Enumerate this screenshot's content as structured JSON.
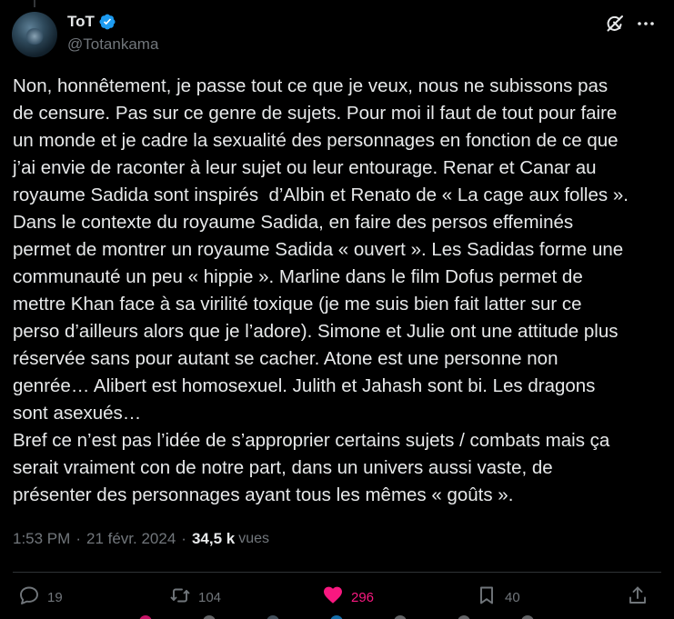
{
  "colors": {
    "accent_blue": "#1d9bf0",
    "like_pink": "#f91880",
    "muted": "#71767b",
    "text": "#e7e9ea",
    "bg": "#000000"
  },
  "author": {
    "display_name": "ToT",
    "handle": "@Totankama",
    "verified": true
  },
  "post": {
    "text": "Non, honnêtement, je passe tout ce que je veux, nous ne subissons pas\nde censure. Pas sur ce genre de sujets. Pour moi il faut de tout pour faire\nun monde et je cadre la sexualité des personnages en fonction de ce que\nj’ai envie de raconter à leur sujet ou leur entourage. Renar et Canar au\nroyaume Sadida sont inspirés  d’Albin et Renato de « La cage aux folles ».\nDans le contexte du royaume Sadida, en faire des persos effeminés\npermet de montrer un royaume Sadida « ouvert ». Les Sadidas forme une\ncommunauté un peu « hippie ». Marline dans le film Dofus permet de\nmettre Khan face à sa virilité toxique (je me suis bien fait latter sur ce\nperso d’ailleurs alors que je l’adore). Simone et Julie ont une attitude plus\nréservée sans pour autant se cacher. Atone est une personne non\ngenrée… Alibert est homosexuel. Julith et Jahash sont bi. Les dragons\nsont asexués…\nBref ce n’est pas l’idée de s’approprier certains sujets / combats mais ça\nserait vraiment con de notre part, dans un univers aussi vaste, de\nprésenter des personnages ayant tous les mêmes « goûts ».",
    "time": "1:53 PM",
    "date": "21 févr. 2024",
    "separator": "·",
    "views_count": "34,5 k",
    "views_label": "vues"
  },
  "actions": {
    "reply": {
      "icon": "reply-icon",
      "count": "19"
    },
    "repost": {
      "icon": "repost-icon",
      "count": "104"
    },
    "like": {
      "icon": "heart-filled-icon",
      "count": "296",
      "liked": true
    },
    "bookmark": {
      "icon": "bookmark-icon",
      "count": "40"
    },
    "share": {
      "icon": "share-icon"
    }
  },
  "header_icons": {
    "grok": "grok-icon",
    "more": "more-horizontal-icon"
  }
}
